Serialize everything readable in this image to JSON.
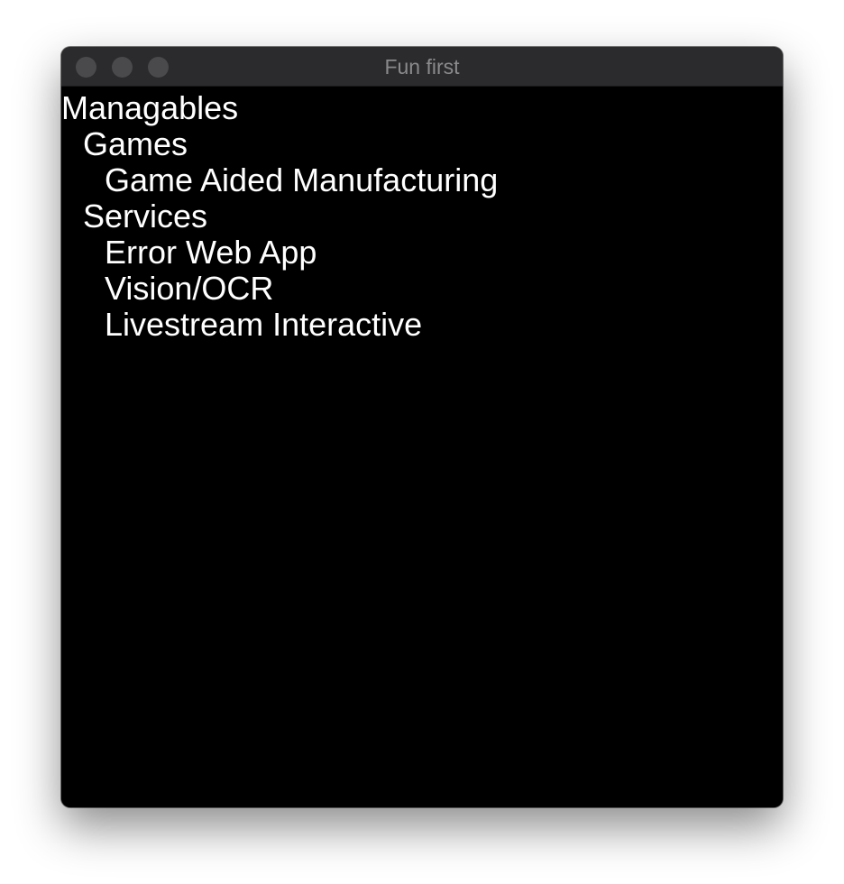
{
  "window": {
    "title": "Fun first"
  },
  "tree": {
    "root": "Managables",
    "games": "Games",
    "game_aided_manufacturing": "Game Aided Manufacturing",
    "services": "Services",
    "error_web_app": "Error Web App",
    "vision_ocr": "Vision/OCR",
    "livestream_interactive": "Livestream Interactive"
  }
}
